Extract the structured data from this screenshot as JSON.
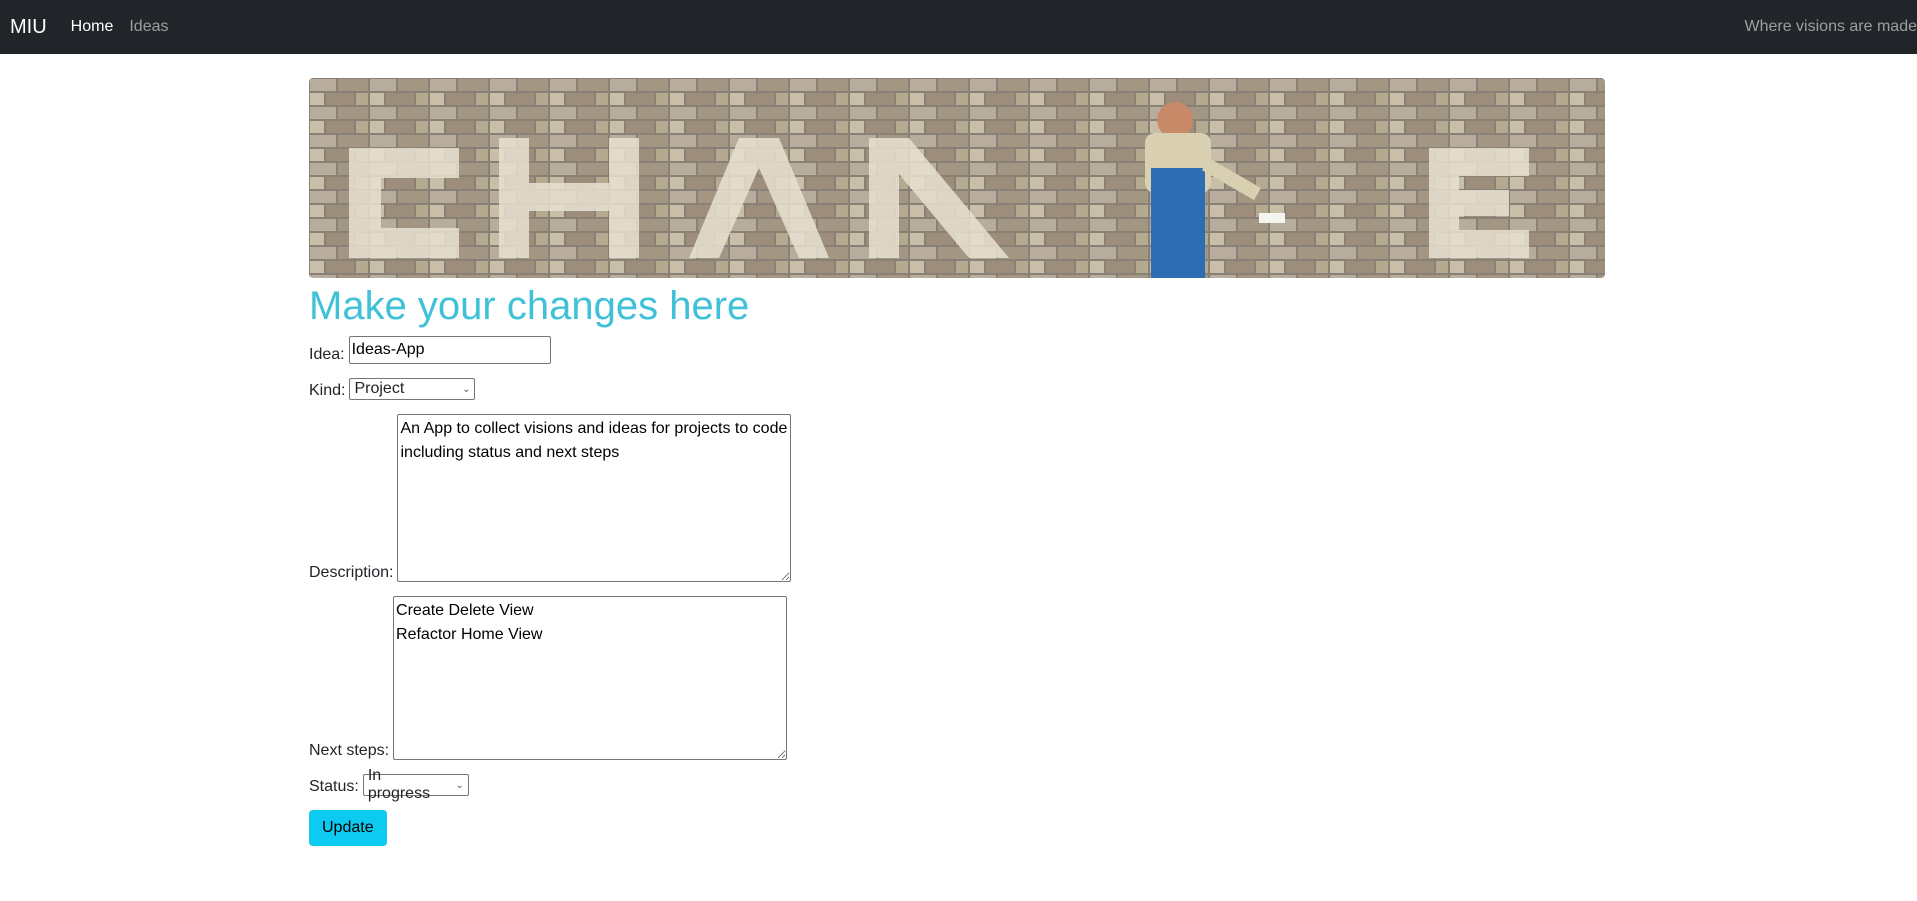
{
  "navbar": {
    "brand": "MIU",
    "links": [
      {
        "label": "Home",
        "active": true
      },
      {
        "label": "Ideas",
        "active": false
      }
    ],
    "tagline": "Where visions are made"
  },
  "page": {
    "title": "Make your changes here"
  },
  "form": {
    "idea": {
      "label": "Idea:",
      "value": "Ideas-App"
    },
    "kind": {
      "label": "Kind:",
      "value": "Project"
    },
    "description": {
      "label": "Description:",
      "value": "An App to collect visions and ideas for projects to code including status and next steps"
    },
    "next_steps": {
      "label": "Next steps:",
      "value": "Create Delete View\nRefactor Home View"
    },
    "status": {
      "label": "Status:",
      "value": "In progress"
    },
    "submit_label": "Update"
  },
  "colors": {
    "navbar_bg": "#212529",
    "title": "#3fc1d8",
    "button": "#0dcaf0"
  }
}
